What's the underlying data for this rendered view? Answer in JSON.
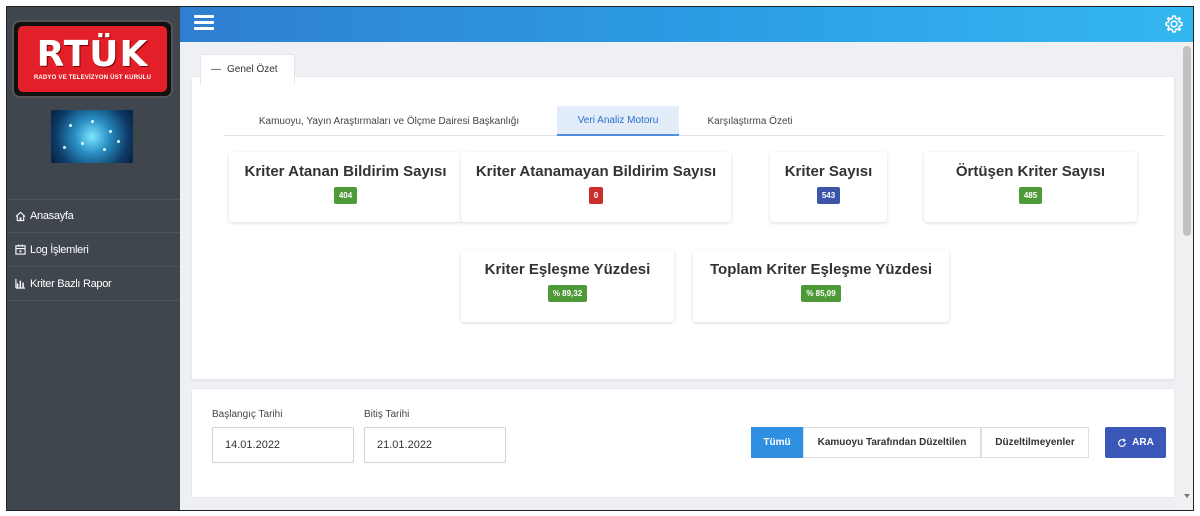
{
  "brand": {
    "logo_text": "RTÜK",
    "logo_subtitle": "RADYO VE TELEVİZYON ÜST KURULU"
  },
  "sidebar": {
    "items": [
      {
        "label": "Anasayfa",
        "icon": "home-icon"
      },
      {
        "label": "Log İşlemleri",
        "icon": "calendar-icon"
      },
      {
        "label": "Kriter Bazlı Rapor",
        "icon": "bar-chart-icon"
      }
    ]
  },
  "panel": {
    "collapse_symbol": "—",
    "title": "Genel Özet"
  },
  "tabs": [
    {
      "label": "Kamuoyu, Yayın Araştırmaları ve Ölçme Dairesi Başkanlığı",
      "active": false
    },
    {
      "label": "Veri Analiz Motoru",
      "active": true
    },
    {
      "label": "Karşılaştırma Özeti",
      "active": false
    }
  ],
  "stats": [
    {
      "label": "Kriter Atanan Bildirim Sayısı",
      "value": "404",
      "color": "#4f9a38"
    },
    {
      "label": "Kriter Atanamayan Bildirim Sayısı",
      "value": "0",
      "color": "#c9302c"
    },
    {
      "label": "Kriter Sayısı",
      "value": "543",
      "color": "#3c55a8"
    },
    {
      "label": "Örtüşen Kriter Sayısı",
      "value": "485",
      "color": "#4f9a38"
    },
    {
      "label": "Kriter Eşleşme Yüzdesi",
      "value": "% 89,32",
      "color": "#4f9a38"
    },
    {
      "label": "Toplam Kriter Eşleşme Yüzdesi",
      "value": "% 85,09",
      "color": "#4f9a38"
    }
  ],
  "filter": {
    "start_label": "Başlangıç Tarihi",
    "start_value": "14.01.2022",
    "end_label": "Bitiş Tarihi",
    "end_value": "21.01.2022",
    "segments": [
      {
        "label": "Tümü",
        "active": true
      },
      {
        "label": "Kamuoyu Tarafından Düzeltilen",
        "active": false
      },
      {
        "label": "Düzeltilmeyenler",
        "active": false
      }
    ],
    "search_icon": "refresh-icon",
    "search_label": "ARA"
  },
  "colors": {
    "topbar": "#2c9ee6",
    "sidebar": "#3f464d",
    "accent": "#2f8fe0",
    "search_button": "#3b57b8"
  }
}
